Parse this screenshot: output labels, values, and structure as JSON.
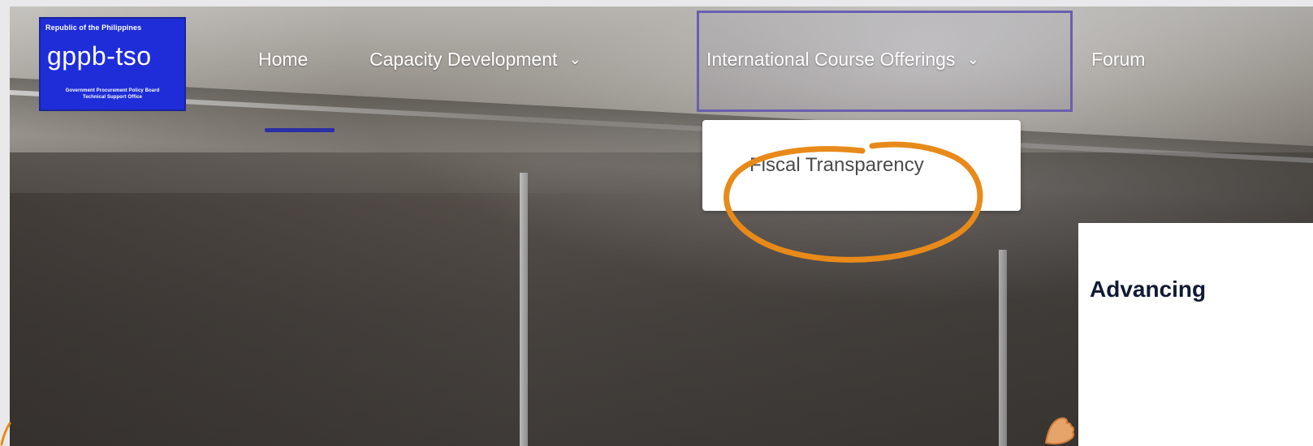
{
  "logo": {
    "top_text": "Republic of the Philippines",
    "main_text": "gppb-tso",
    "sub_line1": "Government Procurement Policy Board",
    "sub_line2": "Technical Support Office"
  },
  "nav": {
    "items": [
      {
        "label": "Home",
        "has_chevron": false
      },
      {
        "label": "Capacity Development",
        "has_chevron": true
      },
      {
        "label": "International Course Offerings",
        "has_chevron": true
      },
      {
        "label": "Forum",
        "has_chevron": false
      }
    ],
    "chevron_glyph": "⌄"
  },
  "dropdown": {
    "items": [
      {
        "label": "Fiscal Transparency"
      }
    ]
  },
  "card": {
    "title": "Advancing"
  },
  "colors": {
    "logo_bg": "#1f2dd8",
    "annotation": "#e88a1a",
    "home_underline": "#2a2fa6",
    "card_title": "#111a33"
  },
  "icons": {
    "chevron": "chevron-down-icon",
    "annotation": "annotation-circle-icon",
    "hand": "hand-icon"
  }
}
